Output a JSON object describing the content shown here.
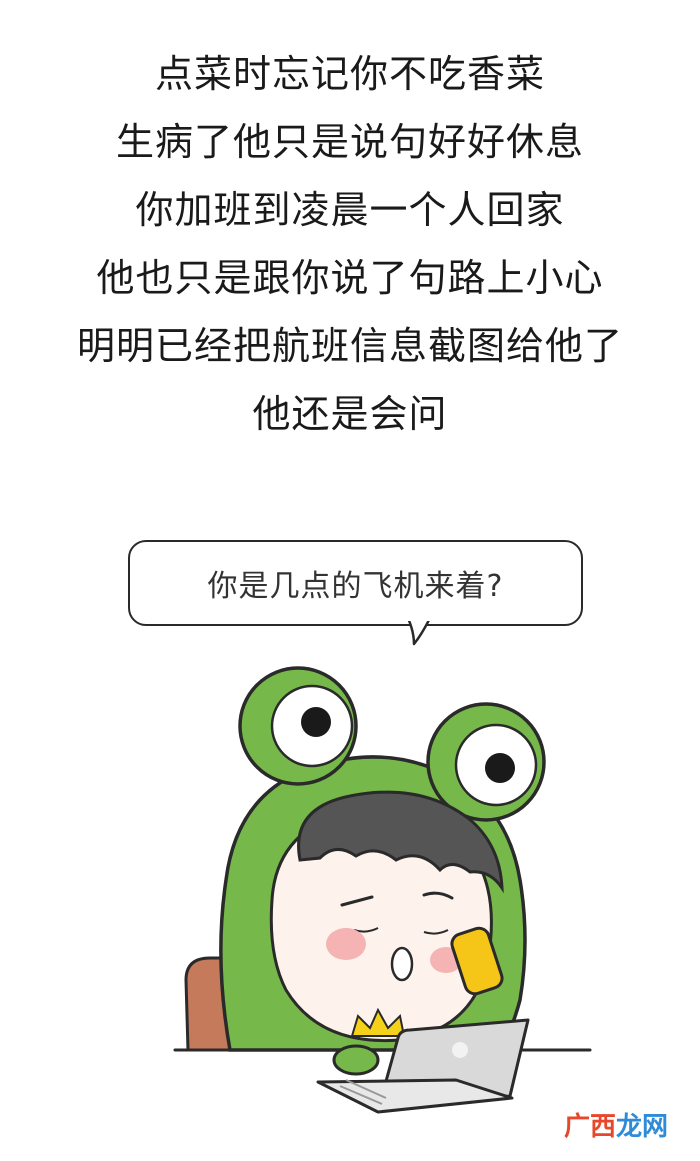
{
  "poem": {
    "lines": [
      "点菜时忘记你不吃香菜",
      "生病了他只是说句好好休息",
      "你加班到凌晨一个人回家",
      "他也只是跟你说了句路上小心",
      "明明已经把航班信息截图给他了",
      "他还是会问"
    ]
  },
  "bubble": {
    "text": "你是几点的飞机来着?"
  },
  "illustration": {
    "subject": "frog-hood-character-on-phone-with-laptop",
    "colors": {
      "hood_green": "#77b84a",
      "hood_outline": "#2a2a2a",
      "hair": "#555555",
      "skin": "#fdf3ec",
      "blush": "#f5b3b3",
      "phone": "#f5c518",
      "crown": "#f5d21a",
      "chair": "#c57a5c",
      "laptop": "#d9d9d9"
    }
  },
  "watermark": {
    "part1": "广西",
    "part2": "龙网"
  }
}
